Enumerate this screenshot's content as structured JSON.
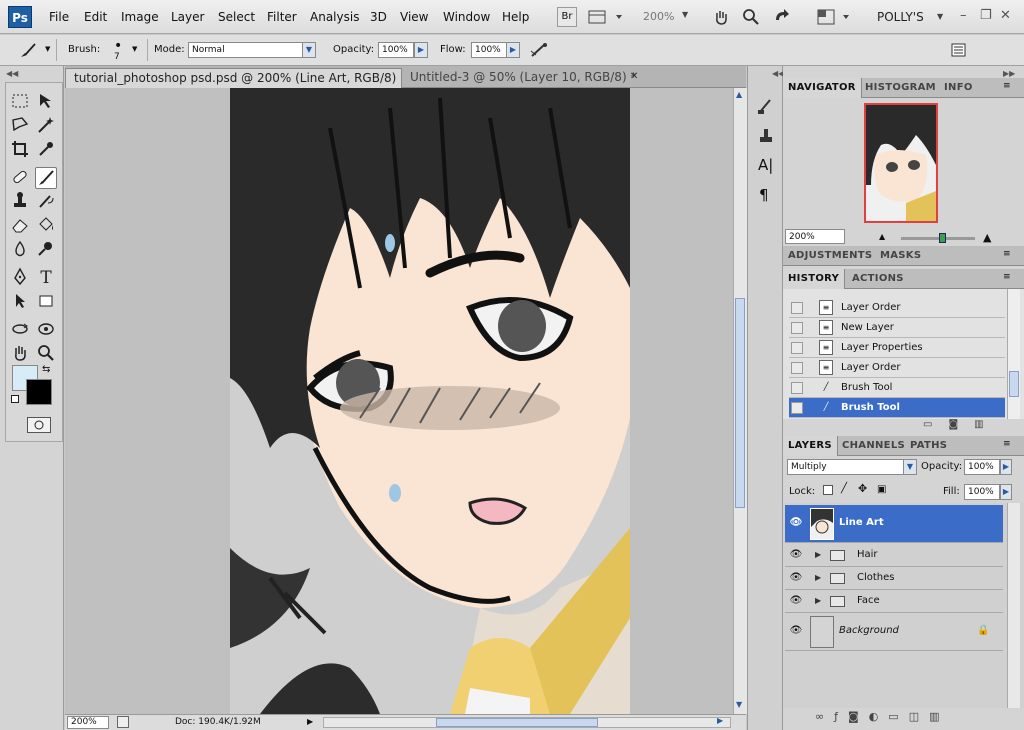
{
  "app": {
    "logo": "Ps",
    "workspace": "POLLY'S",
    "zoom_display": "200%"
  },
  "menu": [
    "File",
    "Edit",
    "Image",
    "Layer",
    "Select",
    "Filter",
    "Analysis",
    "3D",
    "View",
    "Window",
    "Help"
  ],
  "appbar": {
    "br_label": "Br"
  },
  "options": {
    "brush_label": "Brush:",
    "brush_size": "7",
    "mode_label": "Mode:",
    "mode_value": "Normal",
    "opacity_label": "Opacity:",
    "opacity_value": "100%",
    "flow_label": "Flow:",
    "flow_value": "100%"
  },
  "tabs": [
    {
      "label": "tutorial_photoshop psd.psd @ 200% (Line Art, RGB/8)",
      "active": true
    },
    {
      "label": "Untitled-3 @ 50% (Layer 10, RGB/8) *",
      "active": false
    }
  ],
  "status": {
    "zoom": "200%",
    "doc": "Doc: 190.4K/1.92M"
  },
  "navigator": {
    "tabs": [
      "NAVIGATOR",
      "HISTOGRAM",
      "INFO"
    ],
    "zoom": "200%"
  },
  "adjustments": {
    "tabs": [
      "ADJUSTMENTS",
      "MASKS"
    ]
  },
  "history": {
    "tabs": [
      "HISTORY",
      "ACTIONS"
    ],
    "items": [
      {
        "label": "Layer Order",
        "icon": "history-step-icon",
        "selected": false
      },
      {
        "label": "New Layer",
        "icon": "history-step-icon",
        "selected": false
      },
      {
        "label": "Layer Properties",
        "icon": "history-step-icon",
        "selected": false
      },
      {
        "label": "Layer Order",
        "icon": "history-step-icon",
        "selected": false
      },
      {
        "label": "Brush Tool",
        "icon": "brush-icon",
        "selected": false
      },
      {
        "label": "Brush Tool",
        "icon": "brush-icon",
        "selected": true
      }
    ]
  },
  "layers": {
    "tabs": [
      "LAYERS",
      "CHANNELS",
      "PATHS"
    ],
    "blend_mode": "Multiply",
    "opacity_label": "Opacity:",
    "opacity_value": "100%",
    "lock_label": "Lock:",
    "fill_label": "Fill:",
    "fill_value": "100%",
    "items": [
      {
        "name": "Line Art",
        "type": "layer",
        "selected": true
      },
      {
        "name": "Hair",
        "type": "group",
        "selected": false
      },
      {
        "name": "Clothes",
        "type": "group",
        "selected": false
      },
      {
        "name": "Face",
        "type": "group",
        "selected": false
      },
      {
        "name": "Background",
        "type": "background",
        "selected": false
      }
    ]
  },
  "colors": {
    "accent": "#3a6cc8",
    "foreground": "#000000",
    "background": "#d8ecf8"
  }
}
